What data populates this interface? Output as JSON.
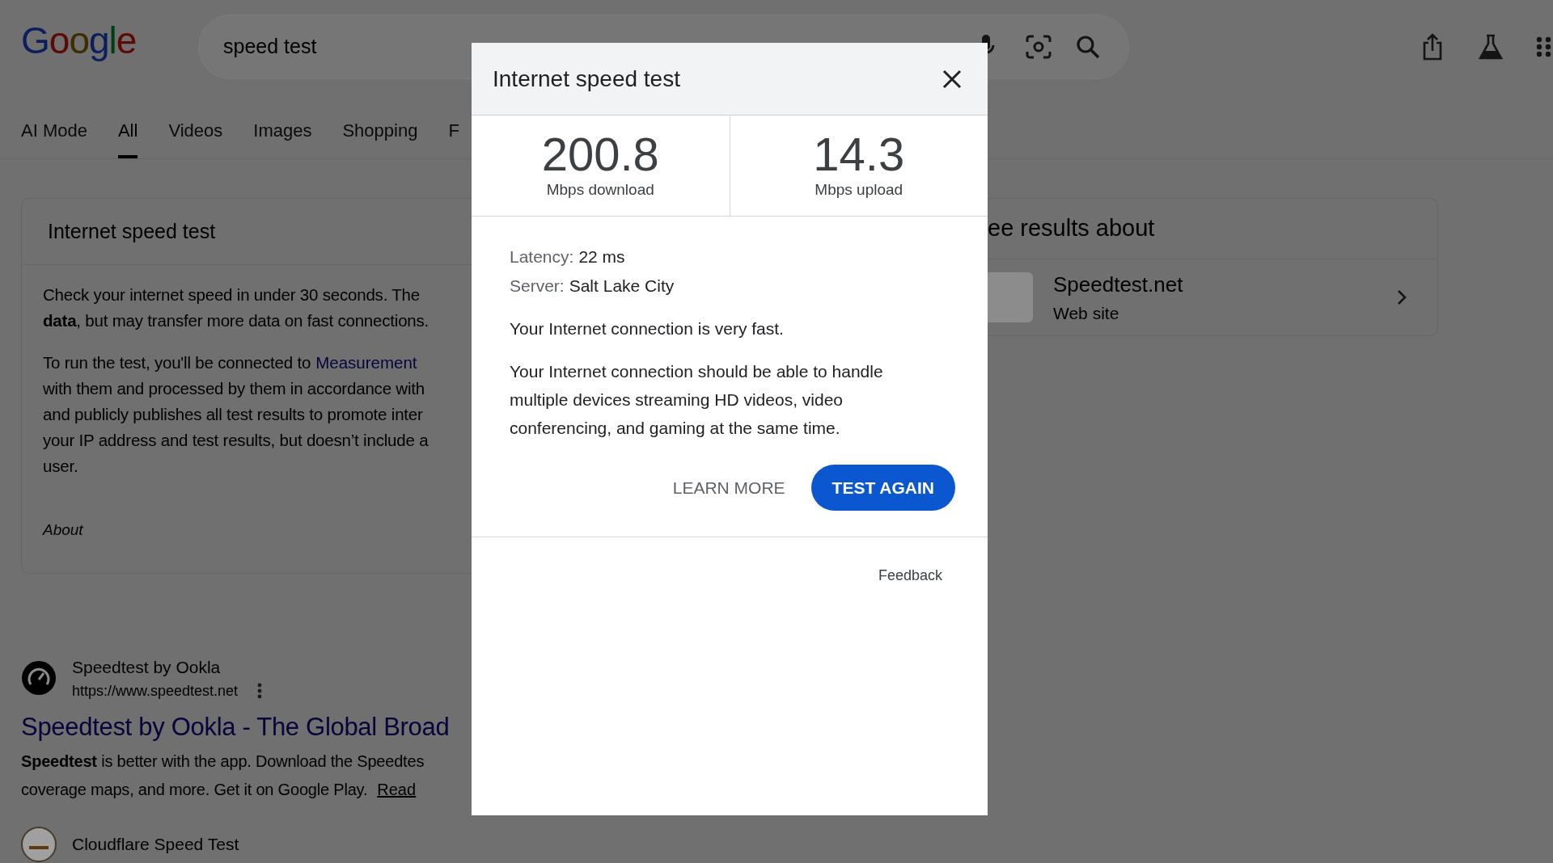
{
  "header": {
    "logo": "Google",
    "search": {
      "value": "speed test"
    }
  },
  "tabs": [
    {
      "label": "AI Mode",
      "selected": false
    },
    {
      "label": "All",
      "selected": true
    },
    {
      "label": "Videos",
      "selected": false
    },
    {
      "label": "Images",
      "selected": false
    },
    {
      "label": "Shopping",
      "selected": false
    },
    {
      "label": "F",
      "selected": false
    }
  ],
  "speed_card": {
    "title": "Internet speed test",
    "paragraphs": [
      {
        "lines": [
          {
            "text": "Check your internet speed in under 30 seconds. The"
          },
          {
            "text": "**data**, but may transfer more data on fast connections."
          }
        ]
      },
      {
        "lines": [
          {
            "text": "To run the test, you'll be connected to",
            "link": "Measurement"
          },
          {
            "text": "with them and processed by them in accordance with"
          },
          {
            "text": "and publicly publishes all test results to promote inter"
          },
          {
            "text": "your IP address and test results, but doesn’t include a"
          },
          {
            "text": "user."
          }
        ]
      }
    ],
    "about": "About"
  },
  "results": [
    {
      "site": "Speedtest by Ookla",
      "url": "https://www.speedtest.net",
      "title": "Speedtest by Ookla - The Global Broad",
      "snippet_lines": [
        "**Speedtest** is better with the app. Download the Speedtes",
        "coverage maps, and more. Get it on Google Play."
      ],
      "read_more": "Read"
    },
    {
      "site": "Cloudflare Speed Test"
    }
  ],
  "see_results": {
    "title": "ee results about",
    "items": [
      {
        "name": "Speedtest.net",
        "type": "Web site"
      }
    ]
  },
  "dialog": {
    "title": "Internet speed test",
    "stats": [
      {
        "value": "200.8",
        "label": "Mbps download"
      },
      {
        "value": "14.3",
        "label": "Mbps upload"
      }
    ],
    "details": [
      {
        "label": "Latency:",
        "value": "22 ms"
      },
      {
        "label": "Server:",
        "value": "Salt Lake City"
      }
    ],
    "messages": [
      "Your Internet connection is very fast.",
      "Your Internet connection should be able to handle multiple devices streaming HD videos, video conferencing, and gaming at the same time."
    ],
    "learn_more": "LEARN MORE",
    "test_again": "TEST AGAIN",
    "feedback": "Feedback"
  }
}
